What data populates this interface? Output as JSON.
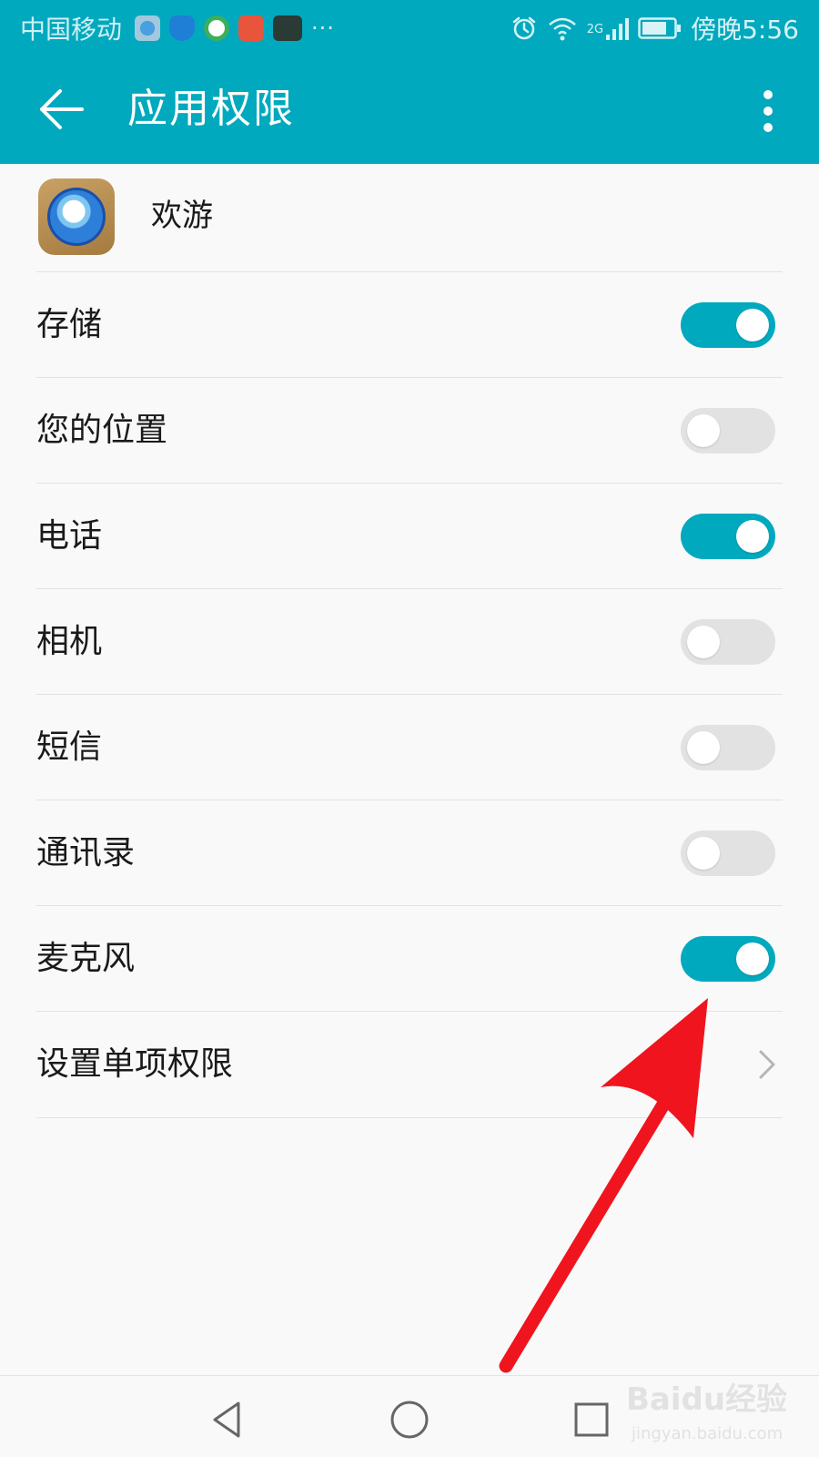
{
  "status_bar": {
    "carrier": "中国移动",
    "overflow": "···",
    "network": "2G",
    "time": "傍晚5:56"
  },
  "app_bar": {
    "title": "应用权限"
  },
  "app": {
    "name": "欢游"
  },
  "permissions": [
    {
      "label": "存储",
      "enabled": true
    },
    {
      "label": "您的位置",
      "enabled": false
    },
    {
      "label": "电话",
      "enabled": true
    },
    {
      "label": "相机",
      "enabled": false
    },
    {
      "label": "短信",
      "enabled": false
    },
    {
      "label": "通讯录",
      "enabled": false
    },
    {
      "label": "麦克风",
      "enabled": true
    }
  ],
  "single_permission": {
    "label": "设置单项权限"
  },
  "watermark": {
    "main": "Baidu经验",
    "sub": "jingyan.baidu.com"
  },
  "colors": {
    "accent": "#01a9be",
    "toggle_off": "#e2e2e2",
    "annotation": "#f0141e"
  }
}
